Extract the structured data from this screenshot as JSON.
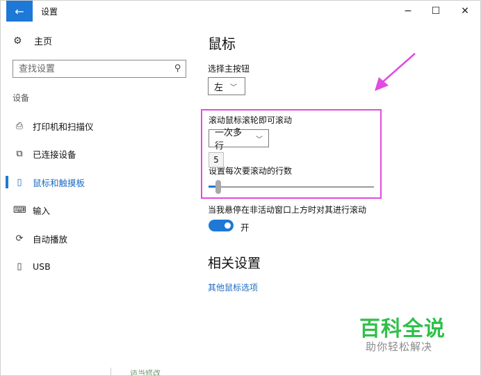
{
  "window": {
    "title": "设置",
    "back_label": "←",
    "minimize_label": "−",
    "maximize_label": "☐",
    "close_label": "✕"
  },
  "sidebar": {
    "home_label": "主页",
    "search_placeholder": "查找设置",
    "group_label": "设备",
    "items": [
      {
        "label": "打印机和扫描仪",
        "icon": "printer-icon",
        "active": false
      },
      {
        "label": "已连接设备",
        "icon": "connected-devices-icon",
        "active": false
      },
      {
        "label": "鼠标和触摸板",
        "icon": "mouse-icon",
        "active": true
      },
      {
        "label": "输入",
        "icon": "keyboard-icon",
        "active": false
      },
      {
        "label": "自动播放",
        "icon": "autoplay-icon",
        "active": false
      },
      {
        "label": "USB",
        "icon": "usb-icon",
        "active": false
      }
    ]
  },
  "main": {
    "title": "鼠标",
    "primary_button": {
      "label": "选择主按钮",
      "value": "左"
    },
    "scroll": {
      "label": "滚动鼠标滚轮即可滚动",
      "value": "一次多行"
    },
    "lines": {
      "tooltip_value": "5",
      "label": "设置每次要滚动的行数",
      "level": 0.05
    },
    "inactive_scroll": {
      "label": "当我悬停在非活动窗口上方时对其进行滚动",
      "state": "开"
    },
    "related_title": "相关设置",
    "related_link": "其他鼠标选项"
  },
  "watermark": {
    "line1": "百科全说",
    "line2": "助你轻松解决"
  },
  "bottom_partial_text": "适当修改",
  "colors": {
    "accent": "#1e78d6",
    "highlight": "#e14be0",
    "watermark": "#2fc04a"
  }
}
